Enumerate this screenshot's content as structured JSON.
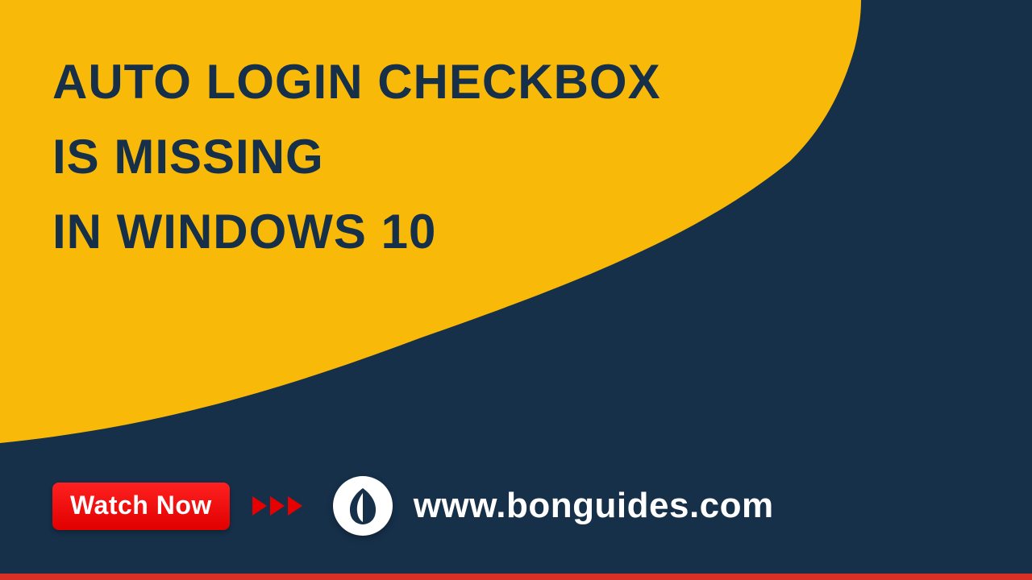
{
  "title": {
    "line1": "AUTO LOGIN CHECKBOX",
    "line2": "IS MISSING",
    "line3": "IN WINDOWS 10"
  },
  "footer": {
    "watch_label": "Watch Now",
    "site_url": "www.bonguides.com"
  },
  "colors": {
    "yellow": "#f9b908",
    "navy": "#16304a",
    "red": "#e60000"
  }
}
